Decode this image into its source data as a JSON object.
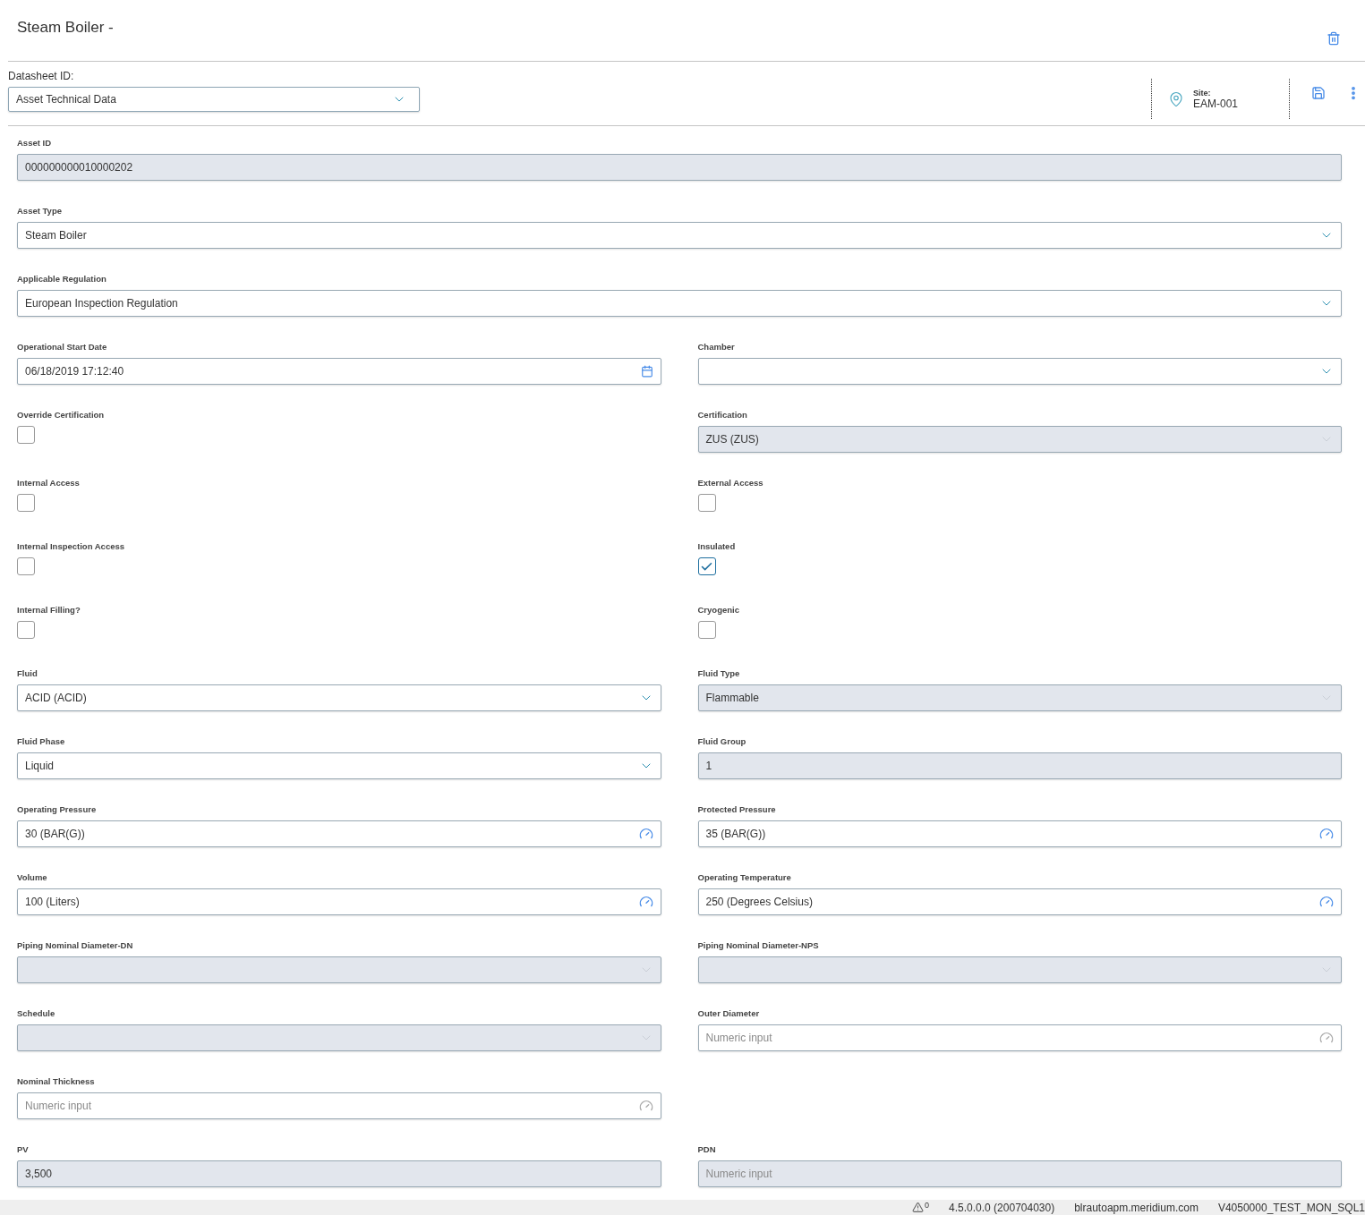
{
  "header": {
    "title": "Steam Boiler -"
  },
  "datasheet": {
    "label": "Datasheet ID:",
    "value": "Asset Technical Data"
  },
  "site": {
    "label": "Site:",
    "value": "EAM-001"
  },
  "rows": [
    {
      "fields": [
        {
          "label": "Asset ID",
          "kind": "text",
          "value": "000000000010000202",
          "disabled": true
        }
      ]
    },
    {
      "fields": [
        {
          "label": "Asset Type",
          "kind": "select",
          "value": "Steam Boiler",
          "disabled": false
        }
      ]
    },
    {
      "fields": [
        {
          "label": "Applicable Regulation",
          "kind": "select",
          "value": "European Inspection Regulation",
          "disabled": false
        }
      ]
    },
    {
      "fields": [
        {
          "label": "Operational Start Date",
          "kind": "date",
          "value": "06/18/2019 17:12:40",
          "disabled": false
        },
        {
          "label": "Chamber",
          "kind": "select",
          "disabled": false
        }
      ]
    },
    {
      "fields": [
        {
          "label": "Override Certification",
          "kind": "checkbox",
          "checked": false
        },
        {
          "label": "Certification",
          "kind": "select",
          "value": "ZUS (ZUS)",
          "disabled": true
        }
      ]
    },
    {
      "fields": [
        {
          "label": "Internal Access",
          "kind": "checkbox",
          "checked": false
        },
        {
          "label": "External Access",
          "kind": "checkbox",
          "checked": false
        }
      ]
    },
    {
      "fields": [
        {
          "label": "Internal Inspection Access",
          "kind": "checkbox",
          "checked": false
        },
        {
          "label": "Insulated",
          "kind": "checkbox",
          "checked": true
        }
      ]
    },
    {
      "fields": [
        {
          "label": "Internal Filling?",
          "kind": "checkbox",
          "checked": false
        },
        {
          "label": "Cryogenic",
          "kind": "checkbox",
          "checked": false
        }
      ]
    },
    {
      "fields": [
        {
          "label": "Fluid",
          "kind": "select",
          "value": "ACID (ACID)",
          "disabled": false
        },
        {
          "label": "Fluid Type",
          "kind": "select",
          "value": "Flammable",
          "disabled": true
        }
      ]
    },
    {
      "fields": [
        {
          "label": "Fluid Phase",
          "kind": "select",
          "value": "Liquid",
          "disabled": false
        },
        {
          "label": "Fluid Group",
          "kind": "text",
          "value": "1",
          "disabled": true
        }
      ]
    },
    {
      "fields": [
        {
          "label": "Operating Pressure",
          "kind": "unit",
          "value": "30 (BAR(G))",
          "disabled": false
        },
        {
          "label": "Protected Pressure",
          "kind": "unit",
          "value": "35 (BAR(G))",
          "disabled": false
        }
      ]
    },
    {
      "fields": [
        {
          "label": "Volume",
          "kind": "unit",
          "value": "100 (Liters)",
          "disabled": false
        },
        {
          "label": "Operating Temperature",
          "kind": "unit",
          "value": "250 (Degrees Celsius)",
          "disabled": false
        }
      ]
    },
    {
      "fields": [
        {
          "label": "Piping Nominal Diameter-DN",
          "kind": "select",
          "disabled": true
        },
        {
          "label": "Piping Nominal Diameter-NPS",
          "kind": "select",
          "disabled": true
        }
      ]
    },
    {
      "fields": [
        {
          "label": "Schedule",
          "kind": "select",
          "disabled": true
        },
        {
          "label": "Outer Diameter",
          "kind": "unit",
          "placeholder": "Numeric input",
          "disabled": false
        }
      ]
    },
    {
      "fields": [
        {
          "label": "Nominal Thickness",
          "kind": "unit",
          "placeholder": "Numeric input",
          "disabled": false
        }
      ]
    },
    {
      "fields": [
        {
          "label": "PV",
          "kind": "text",
          "value": "3,500",
          "disabled": true
        },
        {
          "label": "PDN",
          "kind": "text",
          "placeholder": "Numeric input",
          "disabled": true
        }
      ]
    }
  ],
  "status_bar": {
    "warnings": "0",
    "version": "4.5.0.0.0 (200704030)",
    "host": "blrautoapm.meridium.com",
    "database": "V4050000_TEST_MON_SQL1"
  }
}
